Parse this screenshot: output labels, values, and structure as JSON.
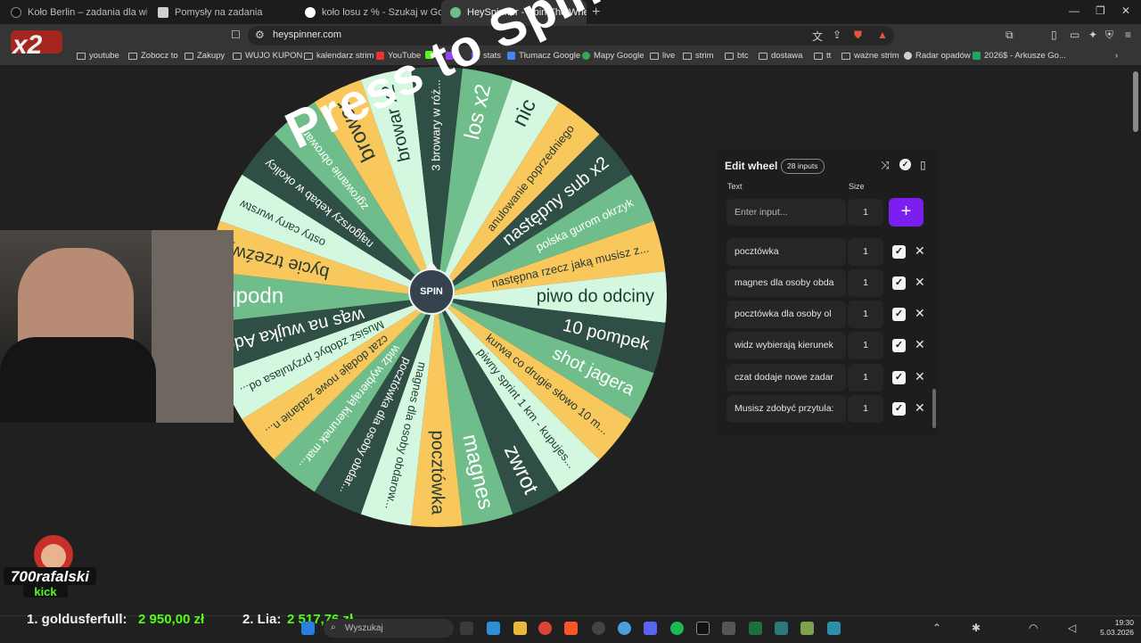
{
  "tabs": [
    {
      "title": "Koło Berlin – zadania dla widzów – G",
      "active": false
    },
    {
      "title": "Pomysły na zadania",
      "active": false
    },
    {
      "title": "koło losu z % - Szukaj w Google",
      "active": false
    },
    {
      "title": "HeySpinner - Spin The Wheel &",
      "active": true
    }
  ],
  "address": {
    "url": "heyspinner.com"
  },
  "bookmarks": [
    "youtube",
    "Zobocz to",
    "Zakupy",
    "WUJO KUPON",
    "kalendarz strim",
    "YouTube",
    "t",
    "stats",
    "Tłumacz Google",
    "Mapy Google",
    "live",
    "strim",
    "btc",
    "dostawa",
    "tt",
    "ważne strim",
    "Radar opadów",
    "2026$ - Arkusze Go..."
  ],
  "wheel": {
    "overlay_text": "Press to Spin",
    "spin_label": "SPIN",
    "segments": [
      {
        "label": "los x2",
        "color": "#6fbd8a",
        "text_color": "#ffffff"
      },
      {
        "label": "nic",
        "color": "#d4f7e0",
        "text_color": "#1e3b30"
      },
      {
        "label": "anulowanie poprzedniego",
        "color": "#f9c85c",
        "text_color": "#263b33"
      },
      {
        "label": "następny sub x2",
        "color": "#2f4e45",
        "text_color": "#ffffff"
      },
      {
        "label": "polska gurom okrzyk",
        "color": "#6fbd8a",
        "text_color": "#ffffff"
      },
      {
        "label": "następna rzecz jaką musisz z...",
        "color": "#f9c85c",
        "text_color": "#263b33"
      },
      {
        "label": "piwo do odciny",
        "color": "#d4f7e0",
        "text_color": "#1e3b30"
      },
      {
        "label": "10 pompek",
        "color": "#2f4e45",
        "text_color": "#ffffff"
      },
      {
        "label": "shot jagera",
        "color": "#6fbd8a",
        "text_color": "#ffffff"
      },
      {
        "label": "kurwa co drugie słowo 10 m...",
        "color": "#f9c85c",
        "text_color": "#263b33"
      },
      {
        "label": "piwny sprint 1 km - kupujes...",
        "color": "#d4f7e0",
        "text_color": "#1e3b30"
      },
      {
        "label": "zwrot",
        "color": "#2f4e45",
        "text_color": "#ffffff"
      },
      {
        "label": "magnes",
        "color": "#6fbd8a",
        "text_color": "#ffffff"
      },
      {
        "label": "pocztówka",
        "color": "#f9c85c",
        "text_color": "#263b33"
      },
      {
        "label": "magnes dla osoby obdarow...",
        "color": "#d4f7e0",
        "text_color": "#1e3b30"
      },
      {
        "label": "pocztówka dla osoby obdar...",
        "color": "#2f4e45",
        "text_color": "#ffffff"
      },
      {
        "label": "widz wybierają kierunek mar...",
        "color": "#6fbd8a",
        "text_color": "#ffffff"
      },
      {
        "label": "czat dodaje nowe zadanie n...",
        "color": "#f9c85c",
        "text_color": "#263b33"
      },
      {
        "label": "Musisz zdobyć przytulasa od...",
        "color": "#d4f7e0",
        "text_color": "#1e3b30"
      },
      {
        "label": "wąs na wujka Ado",
        "color": "#2f4e45",
        "text_color": "#ffffff"
      },
      {
        "label": "upodle",
        "color": "#6fbd8a",
        "text_color": "#ffffff"
      },
      {
        "label": "bycie trzeźwy",
        "color": "#f9c85c",
        "text_color": "#263b33"
      },
      {
        "label": "ostry carry wurstw",
        "color": "#d4f7e0",
        "text_color": "#1e3b30"
      },
      {
        "label": "najgorszy kebab w okolicy",
        "color": "#2f4e45",
        "text_color": "#ffffff"
      },
      {
        "label": "zgrowanie obrowara",
        "color": "#6fbd8a",
        "text_color": "#ffffff"
      },
      {
        "label": "browar",
        "color": "#f9c85c",
        "text_color": "#263b33"
      },
      {
        "label": "browar x2",
        "color": "#d4f7e0",
        "text_color": "#1e3b30"
      },
      {
        "label": "3 browary w róż...",
        "color": "#2f4e45",
        "text_color": "#ffffff"
      }
    ]
  },
  "editor": {
    "title": "Edit wheel",
    "count_badge": "28 inputs",
    "col_text": "Text",
    "col_size": "Size",
    "input_placeholder": "Enter input...",
    "new_size": "1",
    "add_label": "+",
    "rows": [
      {
        "text": "pocztówka",
        "size": "1"
      },
      {
        "text": "magnes dla osoby obda",
        "size": "1"
      },
      {
        "text": "pocztówka dla osoby ol",
        "size": "1"
      },
      {
        "text": "widz wybierają kierunek",
        "size": "1"
      },
      {
        "text": "czat dodaje nowe zadar",
        "size": "1"
      },
      {
        "text": "Musisz zdobyć przytula:",
        "size": "1"
      }
    ]
  },
  "overlay": {
    "badge_text": "x2",
    "streamer_name": "700rafalski",
    "streamer_platform": "kick",
    "ticker": [
      {
        "name": "1. goldusferfull:",
        "amount": "2 950,00 zł"
      },
      {
        "name": "2. Lia:",
        "amount": "2 517,76 zł"
      }
    ]
  },
  "taskbar": {
    "search_placeholder": "Wyszukaj",
    "time": "19:30",
    "date": "5.03.2026"
  }
}
